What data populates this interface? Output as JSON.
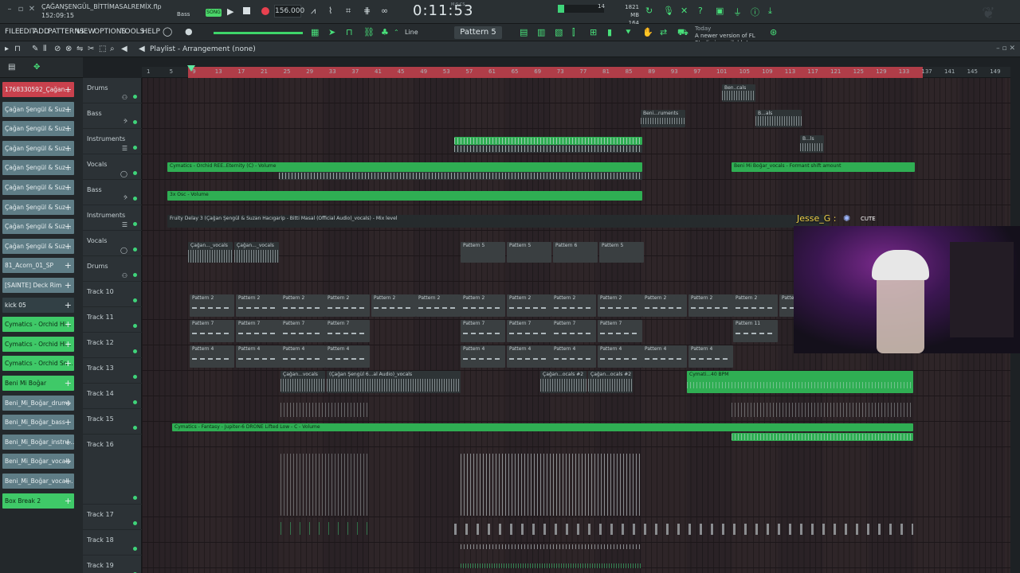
{
  "titlebar": {
    "project_name": "ÇAĞANŞENGÜL_BİTTİMASALREMİX.flp",
    "project_time": "152:09:15",
    "pattern_mode_label": "Bass",
    "song_mode": "SONG",
    "tempo": "156.000",
    "time_display": "0:11:53",
    "time_unit": "M:S:CS",
    "cpu_value": "14",
    "memory_mb": "1821 MB",
    "memory_sub": "164"
  },
  "menu": {
    "items": [
      "FILE",
      "EDIT",
      "ADD",
      "PATTERNS",
      "VIEW",
      "OPTIONS",
      "TOOLS",
      "HELP"
    ],
    "snap": "Line",
    "pattern": "Pattern 5",
    "news_prefix": "Today",
    "news_text": "A newer version of FL Studio is available!"
  },
  "playlist": {
    "title": "Playlist - Arrangement",
    "pattern_ref": "(none)"
  },
  "ruler": {
    "bars": [
      "1",
      "5",
      "9",
      "13",
      "17",
      "21",
      "25",
      "29",
      "33",
      "37",
      "41",
      "45",
      "49",
      "53",
      "57",
      "61",
      "65",
      "69",
      "73",
      "77",
      "81",
      "85",
      "89",
      "93",
      "97",
      "101",
      "105",
      "109",
      "113",
      "117",
      "121",
      "125",
      "129",
      "133",
      "137",
      "141",
      "145",
      "149"
    ]
  },
  "rack": {
    "items": [
      {
        "label": "1768330592_Çağan...",
        "style": "red"
      },
      {
        "label": "Çağan Şengül & Suz...",
        "style": "teal"
      },
      {
        "label": "Çağan Şengül & Suz...",
        "style": "teal"
      },
      {
        "label": "Çağan Şengül & Suz...",
        "style": "teal"
      },
      {
        "label": "Çağan Şengül & Suz...",
        "style": "teal"
      },
      {
        "label": "Çağan Şengül & Suz...",
        "style": "teal"
      },
      {
        "label": "Çağan Şengül & Suz...",
        "style": "teal"
      },
      {
        "label": "Çağan Şengül & Suz...",
        "style": "teal"
      },
      {
        "label": "Çağan Şengül & Suz...",
        "style": "teal"
      },
      {
        "label": "81_Acorn_01_SP",
        "style": "teal"
      },
      {
        "label": "[SAINTE] Deck Rim",
        "style": "teal"
      },
      {
        "label": "kick 05",
        "style": "dark"
      },
      {
        "label": "Cymatics - Orchid Hi...",
        "style": "green"
      },
      {
        "label": "Cymatics - Orchid Hi...",
        "style": "green"
      },
      {
        "label": "Cymatics - Orchid Sn...",
        "style": "green"
      },
      {
        "label": "Beni Mi Boğar",
        "style": "green"
      },
      {
        "label": "Beni_Mi_Boğar_drums",
        "style": "teal"
      },
      {
        "label": "Beni_Mi_Boğar_bass",
        "style": "teal"
      },
      {
        "label": "Beni_Mi_Boğar_instru...",
        "style": "teal"
      },
      {
        "label": "Beni_Mi_Boğar_vocals",
        "style": "teal"
      },
      {
        "label": "Beni_Mi_Boğar_vocal...",
        "style": "teal"
      },
      {
        "label": "Box Break 2",
        "style": "green"
      }
    ]
  },
  "tracks": [
    {
      "name": "Drums",
      "sym": "⚇"
    },
    {
      "name": "Bass",
      "sym": "𝄢"
    },
    {
      "name": "Instruments",
      "sym": "☰"
    },
    {
      "name": "Vocals",
      "sym": "◯"
    },
    {
      "name": "Bass",
      "sym": "𝄢"
    },
    {
      "name": "Instruments",
      "sym": "☰"
    },
    {
      "name": "Vocals",
      "sym": "◯"
    },
    {
      "name": "Drums",
      "sym": "⚇"
    },
    {
      "name": "Track 10",
      "sym": ""
    },
    {
      "name": "Track 11",
      "sym": ""
    },
    {
      "name": "Track 12",
      "sym": ""
    },
    {
      "name": "Track 13",
      "sym": ""
    },
    {
      "name": "Track 14",
      "sym": ""
    },
    {
      "name": "Track 15",
      "sym": ""
    },
    {
      "name": "Track 16",
      "sym": ""
    },
    {
      "name": "Track 17",
      "sym": ""
    },
    {
      "name": "Track 18",
      "sym": ""
    },
    {
      "name": "Track 19",
      "sym": ""
    }
  ],
  "clips": {
    "ben_cals": "Ben..cals",
    "beni_ruments": "Beni...ruments",
    "b_als": "B...als",
    "b_ls": "B...ls",
    "orchid_volume": "Cymatics - Orchid REE..Eternity (C) - Volume",
    "formant": "Beni Mi Boğar_vocals - Formant shift amount",
    "osc_volume": "3x Osc - Volume",
    "fruity_delay": "Fruity Delay 3 (Çağan Şengül & Suzan Hacıgarip - Bitti Masal (Official Audio)_vocals) - Mix level",
    "cagan_vocals": "Çağan..._vocals",
    "pattern2": "Pattern 2",
    "pattern4": "Pattern 4",
    "pattern5": "Pattern 5",
    "pattern6": "Pattern 6",
    "pattern7": "Pattern 7",
    "pattern11": "Pattern 11",
    "cagan_vocals2": "Çağan...vocals",
    "cagan_audio": "(Çağan Şengül 6...al Audio)_vocals",
    "cagan_ocals2": "Çağan...ocals #2",
    "cymatics_bpm": "Cymati...40 BPM",
    "fantasy": "Cymatics - Fantasy - Jupiter-6 DRONE Lifted Low - C - Volume"
  },
  "webcam": {
    "name": "Jesse_G :",
    "tag": "CUTE"
  }
}
